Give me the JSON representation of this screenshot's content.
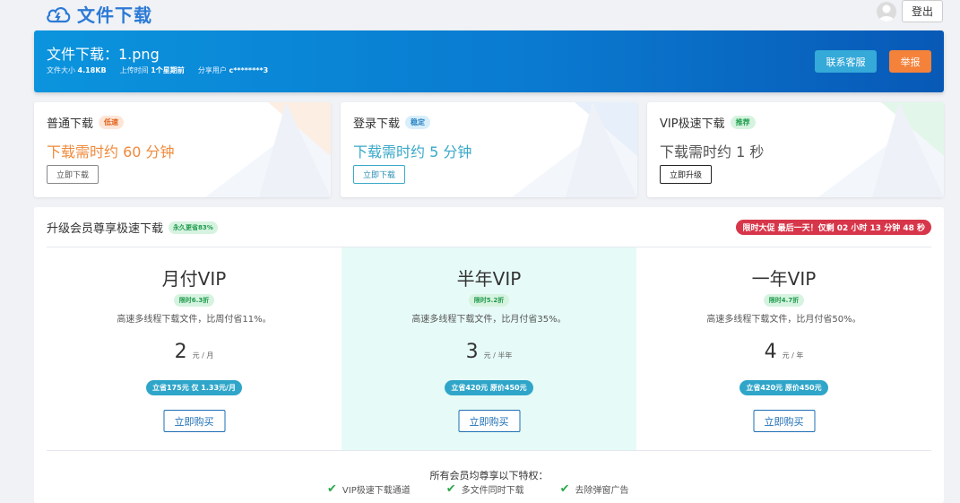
{
  "header": {
    "logo_text": "文件下载",
    "logout_label": "登出"
  },
  "banner": {
    "title": "文件下载：1.png",
    "size_label": "文件大小",
    "size_value": "4.18KB",
    "upload_label": "上传时间",
    "upload_value": "1个星期前",
    "sharer_label": "分享用户",
    "sharer_value": "c********3",
    "contact_label": "联系客服",
    "report_label": "举报"
  },
  "download_options": [
    {
      "title": "普通下载",
      "tag": "低速",
      "time": "下载需时约 60 分钟",
      "button": "立即下载"
    },
    {
      "title": "登录下载",
      "tag": "稳定",
      "time": "下载需时约 5 分钟",
      "button": "立即下载"
    },
    {
      "title": "VIP极速下载",
      "tag": "推荐",
      "time": "下载需时约 1 秒",
      "button": "立即升级"
    }
  ],
  "vip": {
    "title": "升级会员尊享极速下载",
    "tag": "永久更省83%",
    "promo": "限时大促 最后一天！仅剩 02 小时 13 分钟 48 秒",
    "plans": [
      {
        "name": "月付VIP",
        "discount": "限时6.3折",
        "desc": "高速多线程下载文件，比周付省11%。",
        "price": "2",
        "unit": "元 / 月",
        "save": "立省175元 仅 1.33元/月",
        "buy": "立即购买"
      },
      {
        "name": "半年VIP",
        "discount": "限时5.2折",
        "desc": "高速多线程下载文件，比月付省35%。",
        "price": "3",
        "unit": "元 / 半年",
        "save": "立省420元 原价450元",
        "buy": "立即购买"
      },
      {
        "name": "一年VIP",
        "discount": "限时4.7折",
        "desc": "高速多线程下载文件，比月付省50%。",
        "price": "4",
        "unit": "元 / 年",
        "save": "立省420元 原价450元",
        "buy": "立即购买"
      }
    ],
    "benefits_title": "所有会员均尊享以下特权：",
    "benefits": [
      "VIP极速下载通道",
      "多文件同时下载",
      "去除弹窗广告"
    ]
  },
  "colors": {
    "brand_blue": "#2b7ad6",
    "orange_time": "#ef8a3c",
    "teal_time": "#3aa8c8",
    "promo_red": "#d7364a"
  }
}
